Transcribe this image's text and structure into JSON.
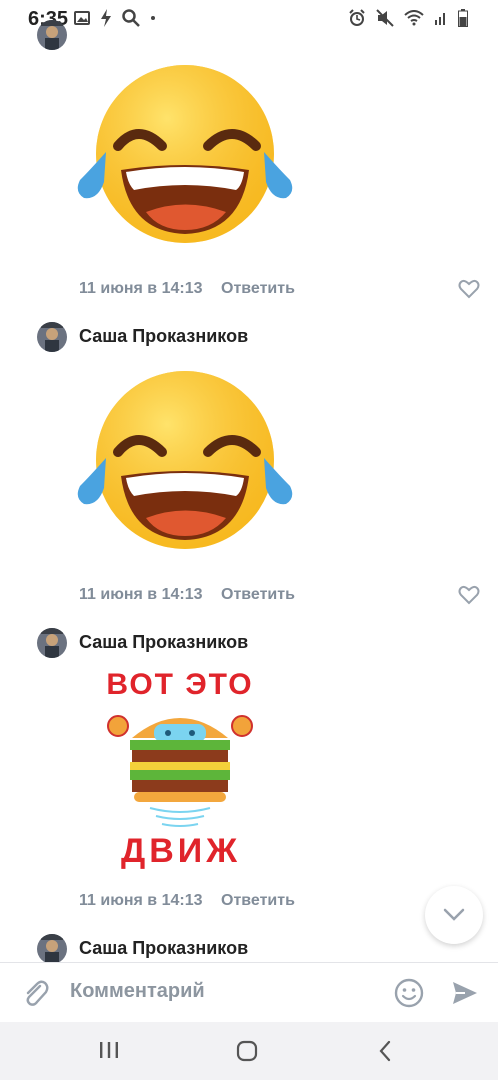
{
  "status_bar": {
    "time": "6:35",
    "left_icons": [
      "image-icon",
      "bolt-icon",
      "search-icon",
      "dot-icon"
    ],
    "right_icons": [
      "alarm-icon",
      "mute-icon",
      "wifi-icon",
      "signal-icon",
      "battery-icon"
    ]
  },
  "comments": [
    {
      "author": "",
      "sticker": "laughing-crying-emoji",
      "date": "11 июня в 14:13",
      "reply_label": "Ответить"
    },
    {
      "author": "Саша Проказников",
      "sticker": "laughing-crying-emoji",
      "date": "11 июня в 14:13",
      "reply_label": "Ответить"
    },
    {
      "author": "Саша Проказников",
      "sticker": "burger-sticker",
      "sticker_text_top": "ВОТ ЭТО",
      "sticker_text_bottom": "ДВИЖ",
      "date": "11 июня в 14:13",
      "reply_label": "Ответить"
    },
    {
      "author": "Саша Проказников"
    }
  ],
  "composer": {
    "placeholder": "Комментарий"
  },
  "colors": {
    "meta": "#818c99",
    "accent": "#99a2ad",
    "emoji_yellow": "#f9c120"
  },
  "nav_bar": [
    "recents-icon",
    "home-icon",
    "back-icon"
  ]
}
